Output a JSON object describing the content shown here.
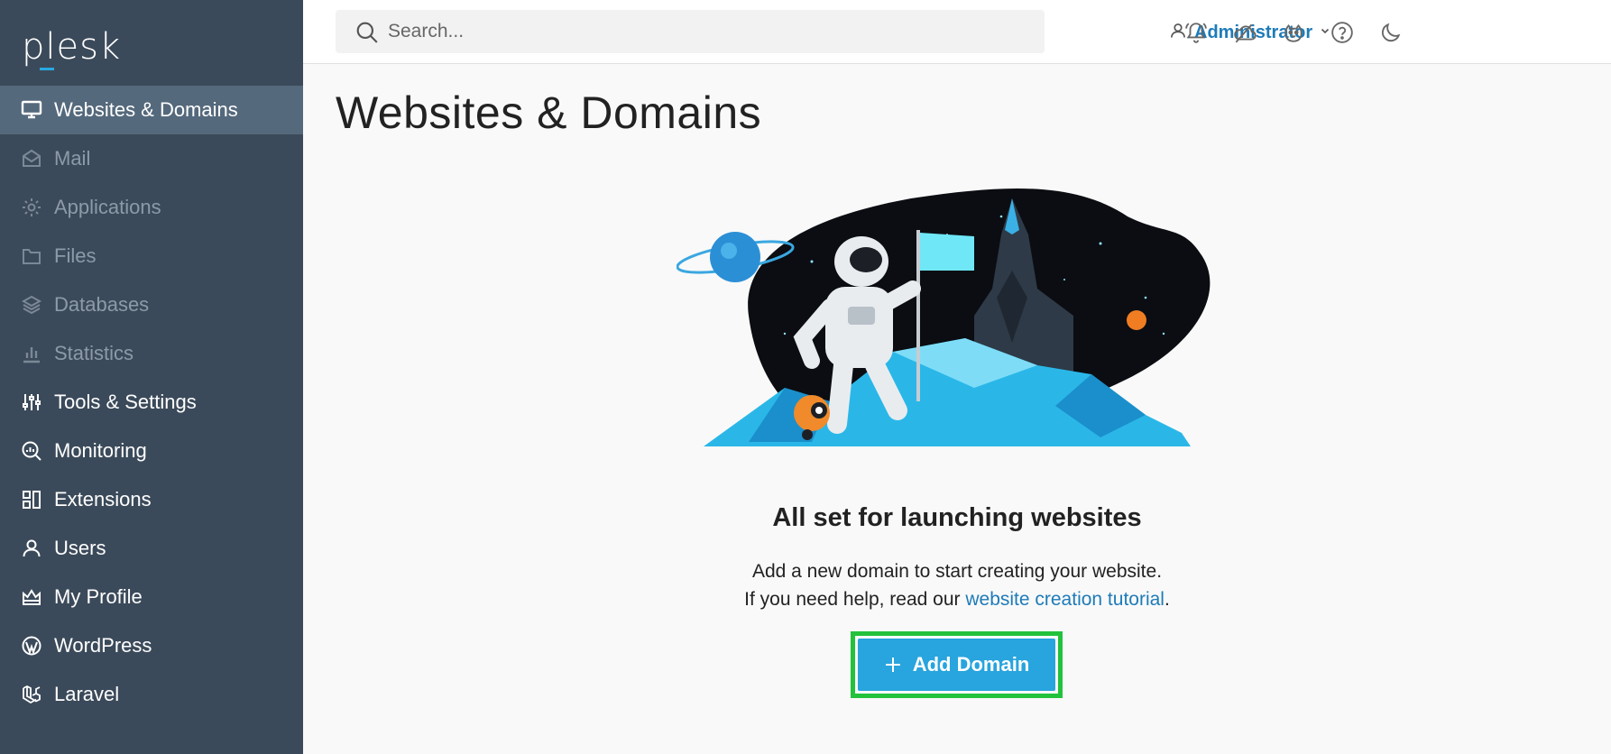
{
  "brand": {
    "logo_text": "plesk"
  },
  "sidebar": {
    "items": [
      {
        "label": "Websites & Domains",
        "icon": "monitor-icon",
        "active": true
      },
      {
        "label": "Mail",
        "icon": "mail-icon",
        "dim": true
      },
      {
        "label": "Applications",
        "icon": "gear-icon",
        "dim": true
      },
      {
        "label": "Files",
        "icon": "folder-icon",
        "dim": true
      },
      {
        "label": "Databases",
        "icon": "layers-icon",
        "dim": true
      },
      {
        "label": "Statistics",
        "icon": "bar-chart-icon",
        "dim": true
      },
      {
        "label": "Tools & Settings",
        "icon": "sliders-icon"
      },
      {
        "label": "Monitoring",
        "icon": "magnifier-chart-icon"
      },
      {
        "label": "Extensions",
        "icon": "extensions-icon"
      },
      {
        "label": "Users",
        "icon": "user-icon"
      },
      {
        "label": "My Profile",
        "icon": "crown-icon"
      },
      {
        "label": "WordPress",
        "icon": "wordpress-icon"
      },
      {
        "label": "Laravel",
        "icon": "laravel-icon"
      }
    ]
  },
  "header": {
    "search_placeholder": "Search...",
    "user_label": "Administrator",
    "icons": [
      "notifications-icon",
      "cloud-icon",
      "theme-mascot-icon",
      "help-icon",
      "dark-mode-icon"
    ]
  },
  "main": {
    "title": "Websites & Domains",
    "empty_title": "All set for launching websites",
    "desc_line1": "Add a new domain to start creating your website.",
    "desc_line2_prefix": "If you need help, read our ",
    "desc_link": "website creation tutorial",
    "desc_line2_suffix": ".",
    "add_button": "Add Domain"
  },
  "colors": {
    "sidebar_bg": "#3b4a5a",
    "sidebar_active": "#55697c",
    "accent": "#28a4de",
    "link": "#1e7bb8",
    "highlight": "#22c23c"
  }
}
